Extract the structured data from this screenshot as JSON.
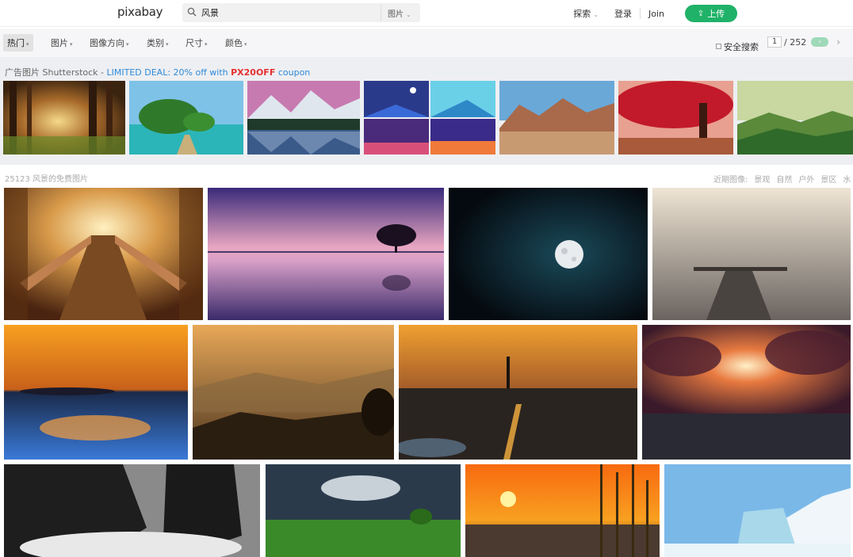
{
  "header": {
    "logo": "pixabay",
    "search_value": "风景",
    "search_type": "图片",
    "nav_explore": "探索",
    "nav_login": "登录",
    "nav_join": "Join",
    "upload_label": "上传"
  },
  "filters": {
    "items": [
      "热门",
      "图片",
      "图像方向",
      "类别",
      "尺寸",
      "颜色"
    ],
    "safe_search": "安全搜索",
    "page_current": "1",
    "page_total": "/ 252",
    "next_label": "›"
  },
  "ad": {
    "prefix": "广告图片 Shutterstock - ",
    "deal": "LIMITED DEAL: 20% off with ",
    "code": "PX20OFF",
    "coupon": " coupon"
  },
  "results": {
    "count_label": "25123 风景的免费图片",
    "related_label": "近期图像:",
    "related_terms": [
      "景观",
      "自然",
      "户外",
      "景区",
      "水"
    ]
  },
  "icons": {
    "search": "search-icon",
    "upload": "upload-arrow-icon",
    "chevron": "chevron-down-icon"
  },
  "colors": {
    "upload_green": "#1fb268",
    "deal_blue": "#2e8ad8",
    "code_red": "#e53030"
  }
}
